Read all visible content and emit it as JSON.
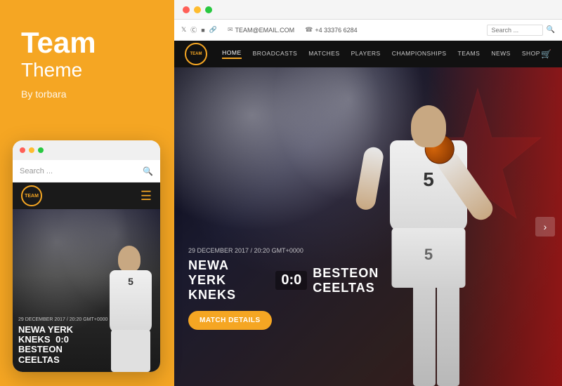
{
  "brand": {
    "title": "Team",
    "subtitle": "Theme",
    "author": "By torbara"
  },
  "mobile": {
    "search_placeholder": "Search ...",
    "logo_text": "TEAM",
    "match_date": "29 DECEMBER 2017 / 20:20 GMT+0000",
    "match_title": "NEWA YERK KNEKS  0:0\nBESTEON CEELTAS",
    "player_number": "5"
  },
  "desktop": {
    "topbar": {
      "dots": [
        "red",
        "yellow",
        "green"
      ]
    },
    "info_bar": {
      "social": [
        "twitter",
        "pinterest",
        "instagram",
        "link"
      ],
      "email": "TEAM@EMAIL.COM",
      "phone": "+4 33376 6284",
      "search_placeholder": "Search ..."
    },
    "nav": {
      "logo_text": "TEAM",
      "items": [
        "HOME",
        "BROADCASTS",
        "MATCHES",
        "PLAYERS",
        "CHAMPIONSHIPS",
        "TEAMS",
        "NEWS",
        "SHOP"
      ],
      "active_item": "HOME"
    },
    "hero": {
      "match_date": "29 DECEMBER 2017 / 20:20 GMT+0000",
      "team_home": "NEWA YERK KNEKS",
      "score": "0:0",
      "team_away": "BESTEON CEELTAS",
      "cta_button": "MATCH DETAILS",
      "player_number": "5"
    }
  }
}
